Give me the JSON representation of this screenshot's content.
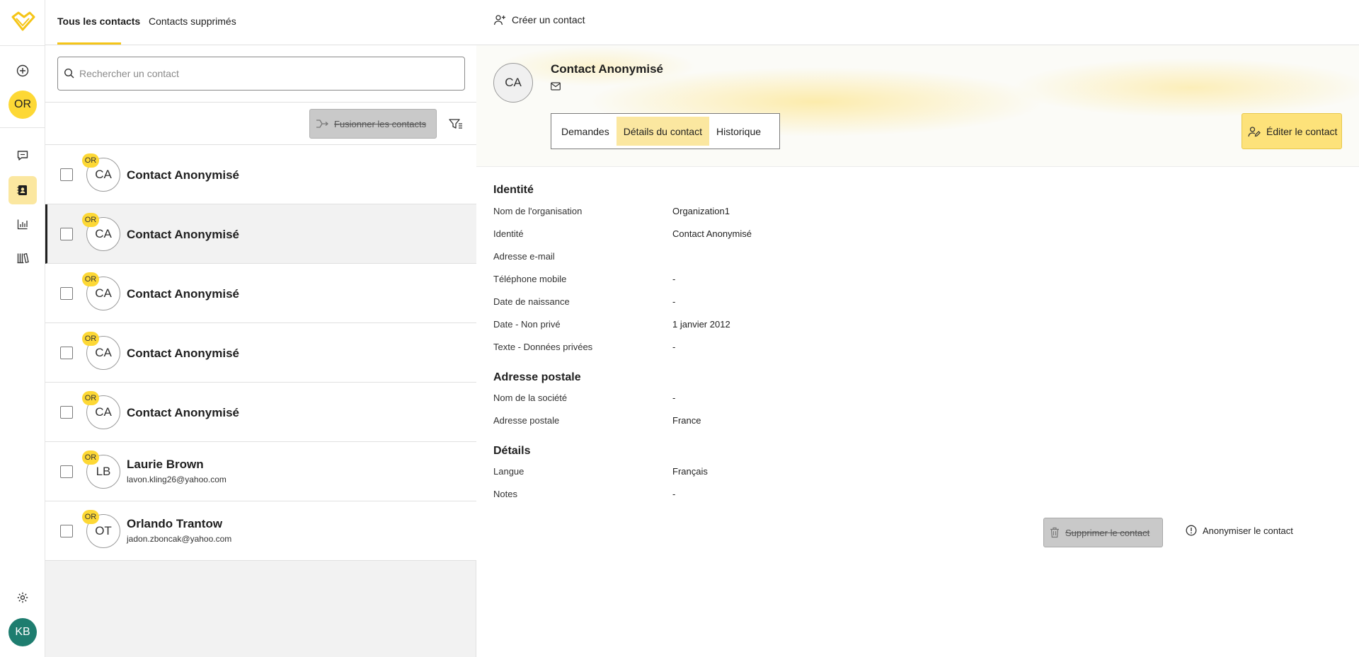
{
  "tabs": {
    "all": "Tous les contacts",
    "deleted": "Contacts supprimés"
  },
  "search": {
    "placeholder": "Rechercher un contact",
    "value": ""
  },
  "toolbar": {
    "merge_label": "Fusionner les contacts"
  },
  "rail": {
    "org_initials": "OR",
    "user_initials": "KB",
    "active_item": "contacts"
  },
  "contacts": [
    {
      "initials": "CA",
      "org": "OR",
      "name": "Contact Anonymisé",
      "email": ""
    },
    {
      "initials": "CA",
      "org": "OR",
      "name": "Contact Anonymisé",
      "email": ""
    },
    {
      "initials": "CA",
      "org": "OR",
      "name": "Contact Anonymisé",
      "email": ""
    },
    {
      "initials": "CA",
      "org": "OR",
      "name": "Contact Anonymisé",
      "email": ""
    },
    {
      "initials": "CA",
      "org": "OR",
      "name": "Contact Anonymisé",
      "email": ""
    },
    {
      "initials": "LB",
      "org": "OR",
      "name": "Laurie Brown",
      "email": "lavon.kling26@yahoo.com"
    },
    {
      "initials": "OT",
      "org": "OR",
      "name": "Orlando Trantow",
      "email": "jadon.zboncak@yahoo.com"
    }
  ],
  "detail": {
    "create_label": "Créer un contact",
    "initials": "CA",
    "name": "Contact Anonymisé",
    "tabs": [
      "Demandes",
      "Détails du contact",
      "Historique"
    ],
    "active_tab": "Détails du contact",
    "edit_label": "Éditer le contact",
    "sections": {
      "identity": {
        "title": "Identité",
        "fields": [
          {
            "label": "Nom de l'organisation",
            "value": "Organization1"
          },
          {
            "label": "Identité",
            "value": "Contact Anonymisé"
          },
          {
            "label": "Adresse e-mail",
            "value": ""
          },
          {
            "label": "Téléphone mobile",
            "value": "-"
          },
          {
            "label": "Date de naissance",
            "value": "-"
          },
          {
            "label": "Date - Non privé",
            "value": "1 janvier 2012"
          },
          {
            "label": "Texte - Données privées",
            "value": "-"
          }
        ]
      },
      "postal": {
        "title": "Adresse postale",
        "fields": [
          {
            "label": "Nom de la société",
            "value": "-"
          },
          {
            "label": "Adresse postale",
            "value": "France"
          }
        ]
      },
      "details": {
        "title": "Détails",
        "fields": [
          {
            "label": "Langue",
            "value": "Français"
          },
          {
            "label": "Notes",
            "value": "-"
          }
        ]
      }
    },
    "delete_label": "Supprimer le contact",
    "anonymize_label": "Anonymiser le contact"
  },
  "colors": {
    "accent": "#fdd835",
    "accent_soft": "#fbe7a0",
    "user_avatar": "#1e7d6f"
  }
}
